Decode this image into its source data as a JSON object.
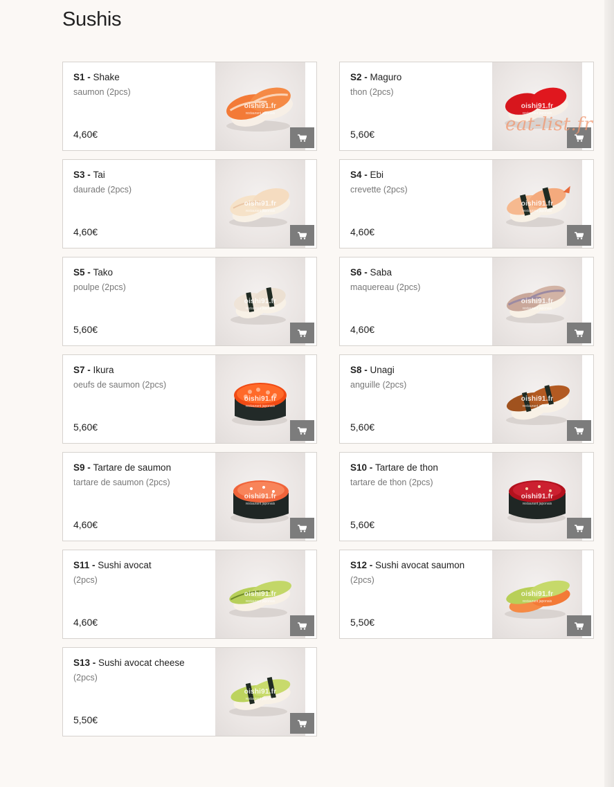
{
  "page": {
    "title": "Sushis"
  },
  "watermark": {
    "site": "oishi91.fr",
    "tagline": "restaurant japonais",
    "overlay": "eat-list.fr"
  },
  "colors": {
    "background": "#fbf8f5",
    "card_border": "#d6d2ce",
    "cart_button": "#7c7c7c"
  },
  "items": [
    {
      "code": "S1",
      "sep": " - ",
      "name": "Shake",
      "desc": "saumon (2pcs)",
      "price": "4,60€",
      "image_icon": "salmon-nigiri"
    },
    {
      "code": "S2",
      "sep": " - ",
      "name": "Maguro",
      "desc": "thon (2pcs)",
      "price": "5,60€",
      "image_icon": "tuna-nigiri"
    },
    {
      "code": "S3",
      "sep": " - ",
      "name": "Tai",
      "desc": "daurade (2pcs)",
      "price": "4,60€",
      "image_icon": "sea-bream-nigiri"
    },
    {
      "code": "S4",
      "sep": " - ",
      "name": "Ebi",
      "desc": "crevette (2pcs)",
      "price": "4,60€",
      "image_icon": "shrimp-nigiri"
    },
    {
      "code": "S5",
      "sep": " - ",
      "name": "Tako",
      "desc": "poulpe (2pcs)",
      "price": "5,60€",
      "image_icon": "octopus-nigiri"
    },
    {
      "code": "S6",
      "sep": " - ",
      "name": "Saba",
      "desc": "maquereau (2pcs)",
      "price": "4,60€",
      "image_icon": "mackerel-nigiri"
    },
    {
      "code": "S7",
      "sep": " - ",
      "name": "Ikura",
      "desc": "oeufs de saumon (2pcs)",
      "price": "5,60€",
      "image_icon": "salmon-roe-gunkan"
    },
    {
      "code": "S8",
      "sep": " - ",
      "name": "Unagi",
      "desc": "anguille (2pcs)",
      "price": "5,60€",
      "image_icon": "eel-nigiri"
    },
    {
      "code": "S9",
      "sep": " - ",
      "name": "Tartare de saumon",
      "desc": "tartare de saumon (2pcs)",
      "price": "4,60€",
      "image_icon": "salmon-tartare-gunkan"
    },
    {
      "code": "S10",
      "sep": " - ",
      "name": "Tartare de thon",
      "desc": "tartare de thon (2pcs)",
      "price": "5,60€",
      "image_icon": "tuna-tartare-gunkan"
    },
    {
      "code": "S11",
      "sep": " - ",
      "name": "Sushi avocat",
      "desc": "(2pcs)",
      "price": "4,60€",
      "image_icon": "avocado-nigiri"
    },
    {
      "code": "S12",
      "sep": " - ",
      "name": "Sushi avocat saumon",
      "desc": "(2pcs)",
      "price": "5,50€",
      "image_icon": "avocado-salmon-nigiri"
    },
    {
      "code": "S13",
      "sep": " - ",
      "name": "Sushi avocat cheese",
      "desc": "(2pcs)",
      "price": "5,50€",
      "image_icon": "avocado-cheese-nigiri"
    }
  ]
}
